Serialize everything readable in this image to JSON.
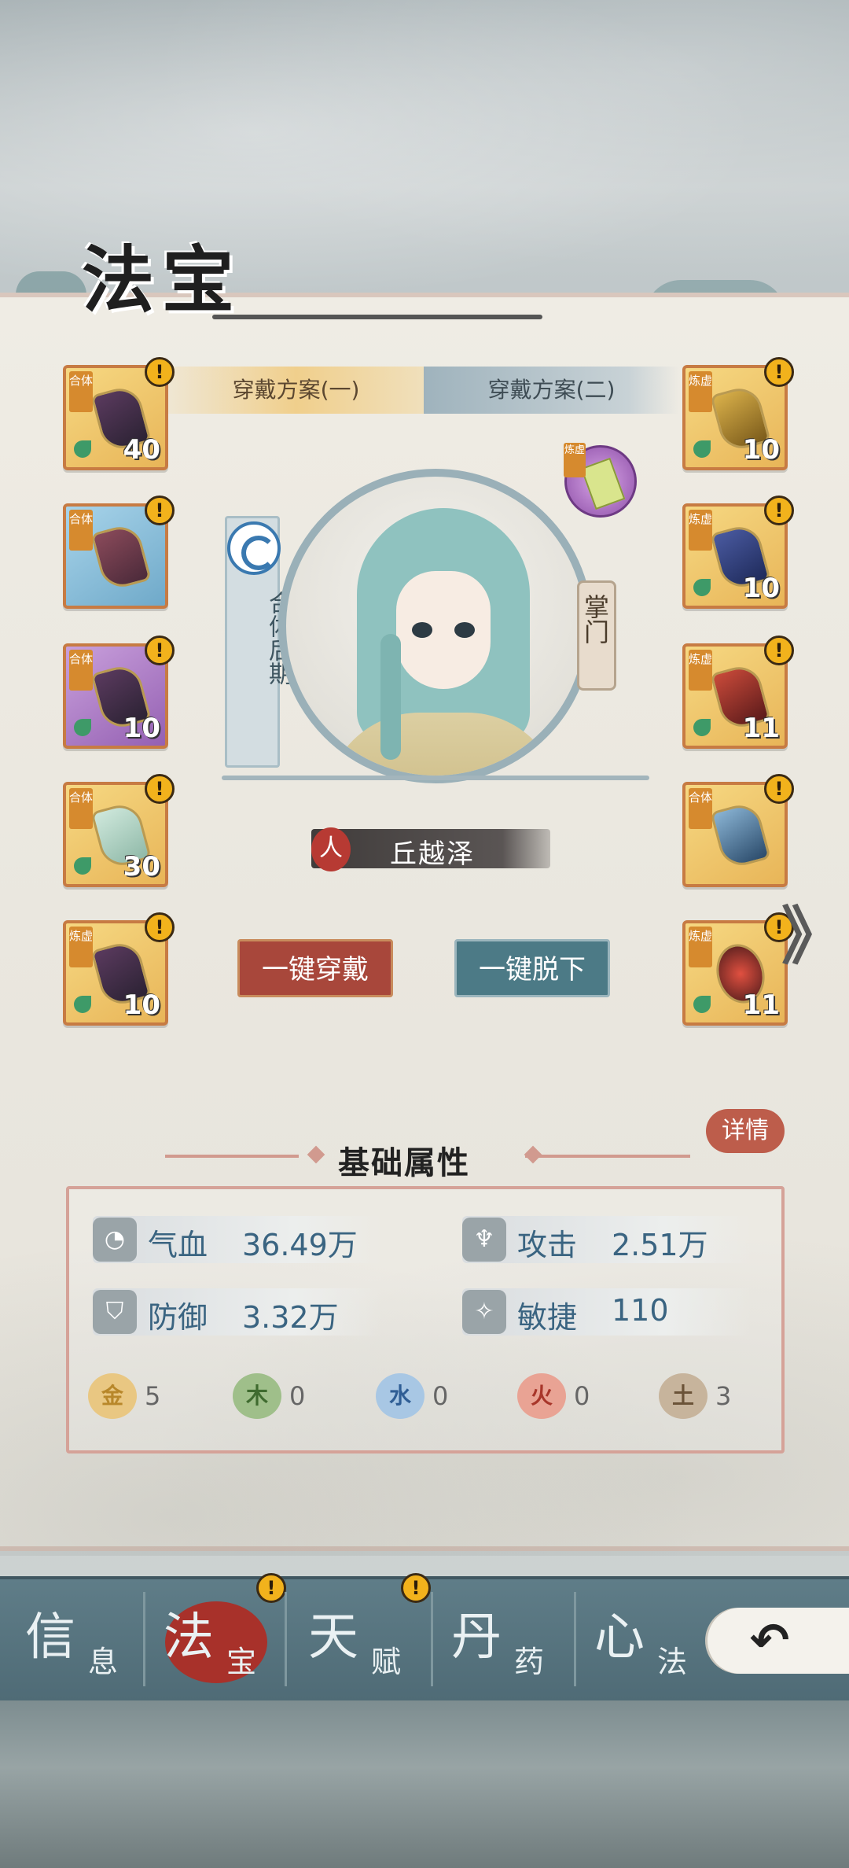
{
  "header": {
    "title": "法宝"
  },
  "plans": [
    {
      "label": "穿戴方案(一)",
      "active": true
    },
    {
      "label": "穿戴方案(二)",
      "active": false
    }
  ],
  "left_slots": [
    {
      "tag": "合体",
      "level": "40",
      "color": "gold",
      "alert": "!"
    },
    {
      "tag": "合体",
      "level": "",
      "color": "blue",
      "alert": "!"
    },
    {
      "tag": "合体",
      "level": "10",
      "color": "purple",
      "alert": "!"
    },
    {
      "tag": "合体",
      "level": "30",
      "color": "gold",
      "alert": "!"
    },
    {
      "tag": "炼虚",
      "level": "10",
      "color": "gold",
      "alert": "!"
    }
  ],
  "right_slots": [
    {
      "tag": "炼虚",
      "level": "10",
      "color": "gold",
      "alert": "!"
    },
    {
      "tag": "炼虚",
      "level": "10",
      "color": "gold",
      "alert": "!"
    },
    {
      "tag": "炼虚",
      "level": "11",
      "color": "gold",
      "alert": "!"
    },
    {
      "tag": "合体",
      "level": "",
      "color": "gold",
      "alert": "!"
    },
    {
      "tag": "炼虚",
      "level": "11",
      "color": "gold",
      "alert": "!"
    }
  ],
  "character": {
    "realm": "合体后期",
    "rank": "掌门",
    "race": "人",
    "name": "丘越泽",
    "orb_tag": "炼虚"
  },
  "buttons": {
    "equip_all": "一键穿戴",
    "unequip_all": "一键脱下",
    "next": "》"
  },
  "attributes": {
    "title": "基础属性",
    "detail": "详情",
    "stats": [
      {
        "label": "气血",
        "value": "36.49万",
        "icon": "blood-icon"
      },
      {
        "label": "攻击",
        "value": "2.51万",
        "icon": "attack-icon"
      },
      {
        "label": "防御",
        "value": "3.32万",
        "icon": "shield-icon"
      },
      {
        "label": "敏捷",
        "value": "110",
        "icon": "agility-icon"
      }
    ],
    "elements": [
      {
        "glyph": "金",
        "value": "5",
        "color": "#e9c782",
        "text": "#b8872a"
      },
      {
        "glyph": "木",
        "value": "0",
        "color": "#9fbf8a",
        "text": "#3f6b2f"
      },
      {
        "glyph": "水",
        "value": "0",
        "color": "#a8c7e4",
        "text": "#2f5e95"
      },
      {
        "glyph": "火",
        "value": "0",
        "color": "#e9a394",
        "text": "#a8362a"
      },
      {
        "glyph": "土",
        "value": "3",
        "color": "#c7b49c",
        "text": "#6b5338"
      }
    ]
  },
  "nav": [
    {
      "big": "信",
      "small": "息",
      "active": false,
      "alert": ""
    },
    {
      "big": "法",
      "small": "宝",
      "active": true,
      "alert": "!"
    },
    {
      "big": "天",
      "small": "赋",
      "active": false,
      "alert": "!"
    },
    {
      "big": "丹",
      "small": "药",
      "active": false,
      "alert": ""
    },
    {
      "big": "心",
      "small": "法",
      "active": false,
      "alert": ""
    }
  ],
  "back_label": "↶"
}
